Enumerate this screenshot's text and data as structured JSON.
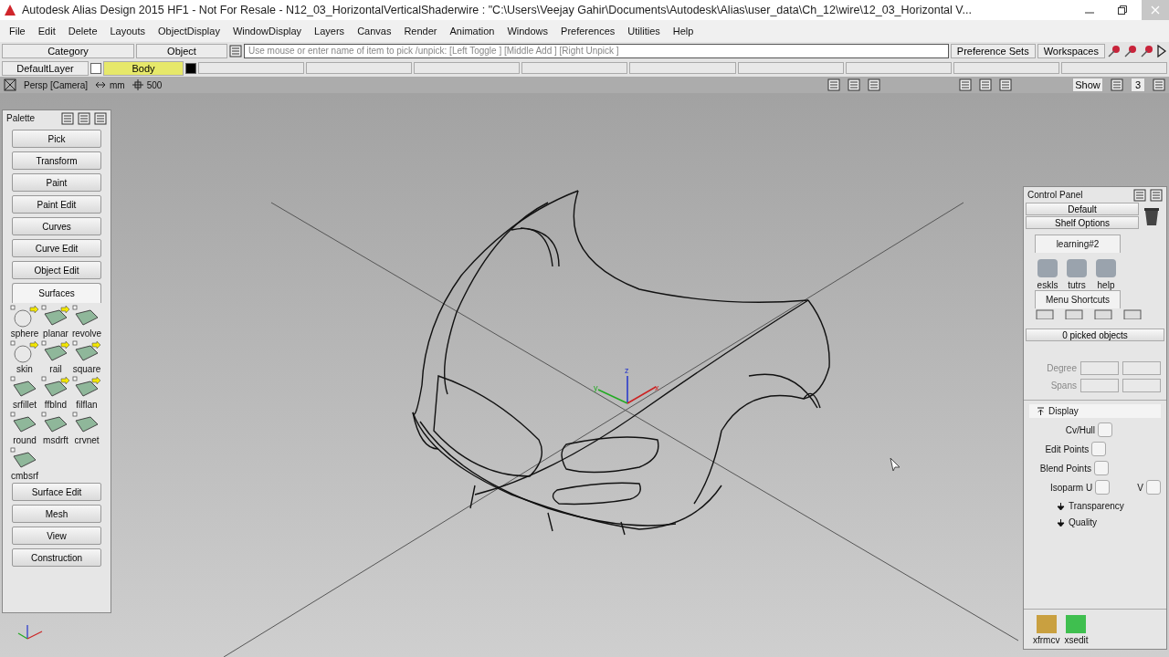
{
  "window": {
    "title": "Autodesk Alias Design 2015 HF1 - Not For Resale   - N12_03_HorizontalVerticalShaderwire : \"C:\\Users\\Veejay Gahir\\Documents\\Autodesk\\Alias\\user_data\\Ch_12\\wire\\12_03_Horizontal V..."
  },
  "menu": [
    "File",
    "Edit",
    "Delete",
    "Layouts",
    "ObjectDisplay",
    "WindowDisplay",
    "Layers",
    "Canvas",
    "Render",
    "Animation",
    "Windows",
    "Preferences",
    "Utilities",
    "Help"
  ],
  "toolbar": {
    "category": "Category",
    "objects": "Object",
    "prompt": "Use mouse or enter name of item to pick /unpick: [Left Toggle ] [Middle Add ] [Right Unpick ]",
    "buttons": [
      "Preference Sets",
      "Workspaces"
    ]
  },
  "layers": [
    {
      "label": "DefaultLayer",
      "color": "#ffffff",
      "selected": false
    },
    {
      "label": "Body",
      "color": "#000000",
      "selected": true
    }
  ],
  "viewbar": {
    "camera": "Persp [Camera]",
    "units": "mm",
    "grid": "500",
    "show": "Show",
    "count": "3"
  },
  "viewport": {
    "axes": [
      "z",
      "y",
      "x"
    ]
  },
  "palette": {
    "title": "Palette",
    "tabs": [
      {
        "label": "Pick",
        "expanded": false
      },
      {
        "label": "Transform",
        "expanded": false
      },
      {
        "label": "Paint",
        "expanded": false
      },
      {
        "label": "Paint Edit",
        "expanded": false
      },
      {
        "label": "Curves",
        "expanded": false
      },
      {
        "label": "Curve Edit",
        "expanded": false
      },
      {
        "label": "Object Edit",
        "expanded": false
      },
      {
        "label": "Surfaces",
        "expanded": true,
        "tools": [
          "sphere",
          "planar",
          "revolve",
          "skin",
          "rail",
          "square",
          "srfillet",
          "ffblnd",
          "filflan",
          "round",
          "msdrft",
          "crvnet",
          "cmbsrf"
        ]
      },
      {
        "label": "Surface Edit",
        "expanded": false
      },
      {
        "label": "Mesh",
        "expanded": false
      },
      {
        "label": "View",
        "expanded": false
      },
      {
        "label": "Construction",
        "expanded": false
      }
    ]
  },
  "control_panel": {
    "title": "Control Panel",
    "preset": "Default",
    "shelf_options": "Shelf Options",
    "shelf_tab": "learning#2",
    "shelf_tools": [
      "eskls",
      "tutrs",
      "help"
    ],
    "shortcuts_tab": "Menu Shortcuts",
    "picked": "0 picked objects",
    "fields": [
      "Degree",
      "Spans"
    ],
    "display": {
      "title": "Display",
      "options": [
        {
          "label": "Cv/Hull",
          "checked": false
        },
        {
          "label": "Edit Points",
          "checked": false
        },
        {
          "label": "Blend Points",
          "checked": false
        },
        {
          "label": "Isoparm U",
          "checked": false,
          "second": "V",
          "second_checked": false
        }
      ],
      "sections": [
        "Transparency",
        "Quality"
      ]
    },
    "bottom_tools": [
      "xfrmcv",
      "xsedit"
    ]
  }
}
